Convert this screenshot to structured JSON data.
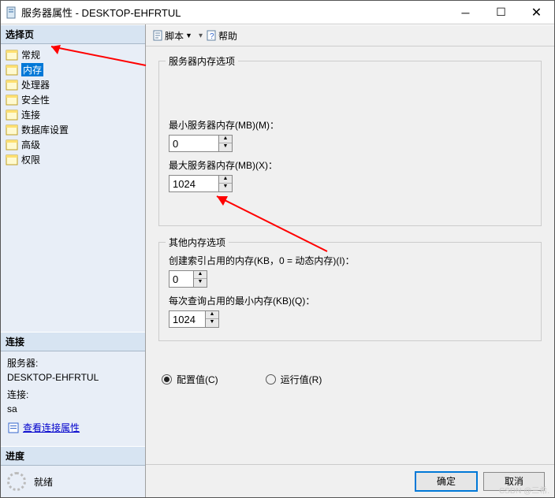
{
  "title": "服务器属性 - DESKTOP-EHFRTUL",
  "sidebar": {
    "header": "选择页",
    "items": [
      {
        "label": "常规"
      },
      {
        "label": "内存",
        "selected": true
      },
      {
        "label": "处理器"
      },
      {
        "label": "安全性"
      },
      {
        "label": "连接"
      },
      {
        "label": "数据库设置"
      },
      {
        "label": "高级"
      },
      {
        "label": "权限"
      }
    ]
  },
  "connection": {
    "header": "连接",
    "server_label": "服务器:",
    "server_value": "DESKTOP-EHFRTUL",
    "conn_label": "连接:",
    "conn_value": "sa",
    "link": "查看连接属性"
  },
  "progress": {
    "header": "进度",
    "status": "就绪"
  },
  "toolbar": {
    "script": "脚本",
    "help": "帮助"
  },
  "main": {
    "server_mem": {
      "legend": "服务器内存选项",
      "min_label": "最小服务器内存(MB)(M)：",
      "min_value": "0",
      "max_label": "最大服务器内存(MB)(X)：",
      "max_value": "1024"
    },
    "other_mem": {
      "legend": "其他内存选项",
      "index_label": "创建索引占用的内存(KB，0 = 动态内存)(I)：",
      "index_value": "0",
      "query_label": "每次查询占用的最小内存(KB)(Q)：",
      "query_value": "1024"
    },
    "radios": {
      "config": "配置值(C)",
      "run": "运行值(R)"
    }
  },
  "footer": {
    "ok": "确定",
    "cancel": "取消"
  },
  "watermark": "CSDN @三希."
}
